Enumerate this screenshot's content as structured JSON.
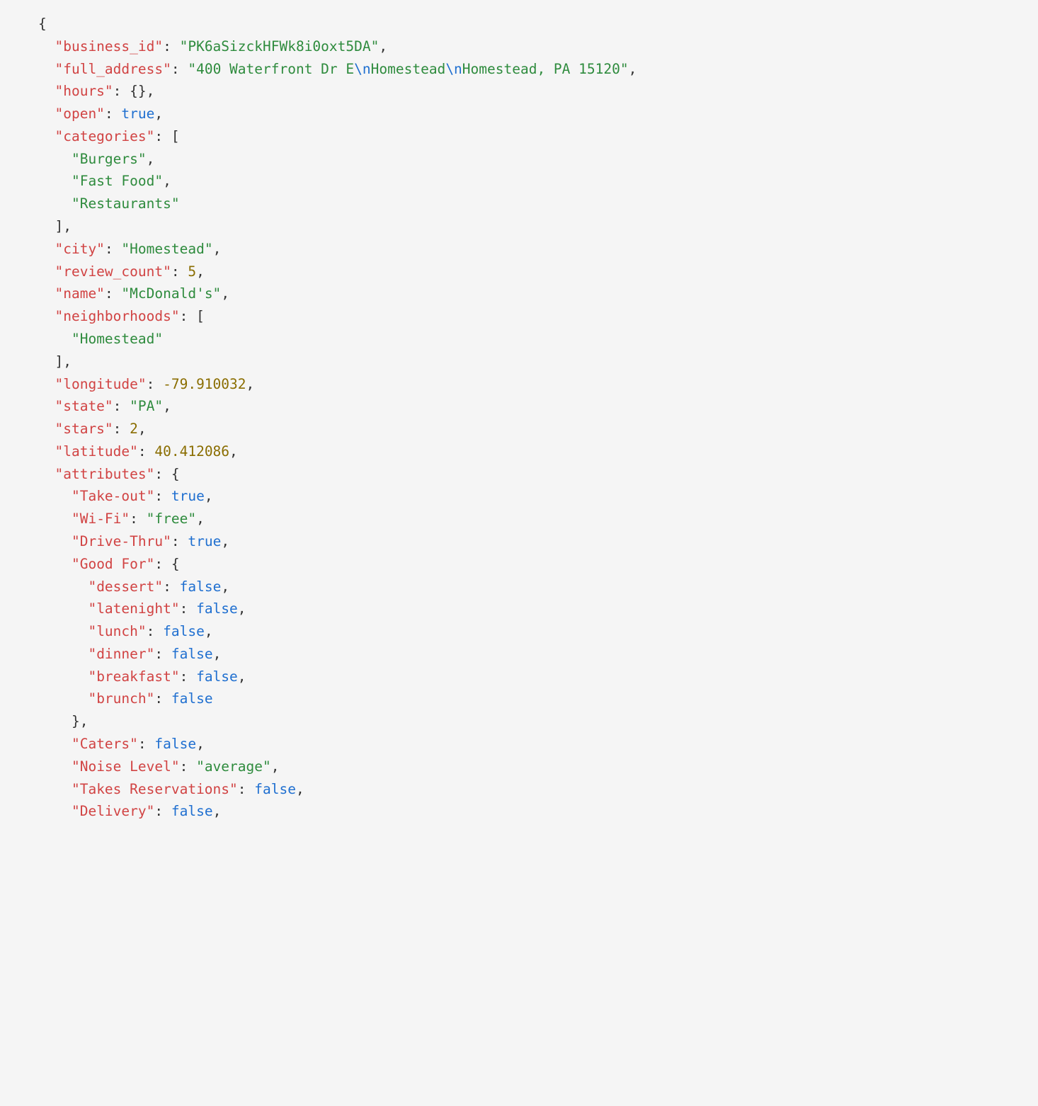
{
  "code": {
    "lines": [
      [
        {
          "cls": "pun",
          "t": "{"
        }
      ],
      [
        {
          "cls": "pun",
          "t": "  "
        },
        {
          "cls": "key",
          "t": "\"business_id\""
        },
        {
          "cls": "pun",
          "t": ": "
        },
        {
          "cls": "str",
          "t": "\"PK6aSizckHFWk8i0oxt5DA\""
        },
        {
          "cls": "pun",
          "t": ","
        }
      ],
      [
        {
          "cls": "pun",
          "t": "  "
        },
        {
          "cls": "key",
          "t": "\"full_address\""
        },
        {
          "cls": "pun",
          "t": ": "
        },
        {
          "cls": "str",
          "t": "\"400 Waterfront Dr E"
        },
        {
          "cls": "esc",
          "t": "\\n"
        },
        {
          "cls": "str",
          "t": "Homestead"
        },
        {
          "cls": "esc",
          "t": "\\n"
        },
        {
          "cls": "str",
          "t": "Homestead, PA 15120\""
        },
        {
          "cls": "pun",
          "t": ","
        }
      ],
      [
        {
          "cls": "pun",
          "t": "  "
        },
        {
          "cls": "key",
          "t": "\"hours\""
        },
        {
          "cls": "pun",
          "t": ": {},"
        }
      ],
      [
        {
          "cls": "pun",
          "t": "  "
        },
        {
          "cls": "key",
          "t": "\"open\""
        },
        {
          "cls": "pun",
          "t": ": "
        },
        {
          "cls": "bool",
          "t": "true"
        },
        {
          "cls": "pun",
          "t": ","
        }
      ],
      [
        {
          "cls": "pun",
          "t": "  "
        },
        {
          "cls": "key",
          "t": "\"categories\""
        },
        {
          "cls": "pun",
          "t": ": ["
        }
      ],
      [
        {
          "cls": "pun",
          "t": "    "
        },
        {
          "cls": "str",
          "t": "\"Burgers\""
        },
        {
          "cls": "pun",
          "t": ","
        }
      ],
      [
        {
          "cls": "pun",
          "t": "    "
        },
        {
          "cls": "str",
          "t": "\"Fast Food\""
        },
        {
          "cls": "pun",
          "t": ","
        }
      ],
      [
        {
          "cls": "pun",
          "t": "    "
        },
        {
          "cls": "str",
          "t": "\"Restaurants\""
        }
      ],
      [
        {
          "cls": "pun",
          "t": "  ],"
        }
      ],
      [
        {
          "cls": "pun",
          "t": "  "
        },
        {
          "cls": "key",
          "t": "\"city\""
        },
        {
          "cls": "pun",
          "t": ": "
        },
        {
          "cls": "str",
          "t": "\"Homestead\""
        },
        {
          "cls": "pun",
          "t": ","
        }
      ],
      [
        {
          "cls": "pun",
          "t": "  "
        },
        {
          "cls": "key",
          "t": "\"review_count\""
        },
        {
          "cls": "pun",
          "t": ": "
        },
        {
          "cls": "num",
          "t": "5"
        },
        {
          "cls": "pun",
          "t": ","
        }
      ],
      [
        {
          "cls": "pun",
          "t": "  "
        },
        {
          "cls": "key",
          "t": "\"name\""
        },
        {
          "cls": "pun",
          "t": ": "
        },
        {
          "cls": "str",
          "t": "\"McDonald's\""
        },
        {
          "cls": "pun",
          "t": ","
        }
      ],
      [
        {
          "cls": "pun",
          "t": "  "
        },
        {
          "cls": "key",
          "t": "\"neighborhoods\""
        },
        {
          "cls": "pun",
          "t": ": ["
        }
      ],
      [
        {
          "cls": "pun",
          "t": "    "
        },
        {
          "cls": "str",
          "t": "\"Homestead\""
        }
      ],
      [
        {
          "cls": "pun",
          "t": "  ],"
        }
      ],
      [
        {
          "cls": "pun",
          "t": "  "
        },
        {
          "cls": "key",
          "t": "\"longitude\""
        },
        {
          "cls": "pun",
          "t": ": "
        },
        {
          "cls": "num",
          "t": "-79.910032"
        },
        {
          "cls": "pun",
          "t": ","
        }
      ],
      [
        {
          "cls": "pun",
          "t": "  "
        },
        {
          "cls": "key",
          "t": "\"state\""
        },
        {
          "cls": "pun",
          "t": ": "
        },
        {
          "cls": "str",
          "t": "\"PA\""
        },
        {
          "cls": "pun",
          "t": ","
        }
      ],
      [
        {
          "cls": "pun",
          "t": "  "
        },
        {
          "cls": "key",
          "t": "\"stars\""
        },
        {
          "cls": "pun",
          "t": ": "
        },
        {
          "cls": "num",
          "t": "2"
        },
        {
          "cls": "pun",
          "t": ","
        }
      ],
      [
        {
          "cls": "pun",
          "t": "  "
        },
        {
          "cls": "key",
          "t": "\"latitude\""
        },
        {
          "cls": "pun",
          "t": ": "
        },
        {
          "cls": "num",
          "t": "40.412086"
        },
        {
          "cls": "pun",
          "t": ","
        }
      ],
      [
        {
          "cls": "pun",
          "t": "  "
        },
        {
          "cls": "key",
          "t": "\"attributes\""
        },
        {
          "cls": "pun",
          "t": ": {"
        }
      ],
      [
        {
          "cls": "pun",
          "t": "    "
        },
        {
          "cls": "key",
          "t": "\"Take-out\""
        },
        {
          "cls": "pun",
          "t": ": "
        },
        {
          "cls": "bool",
          "t": "true"
        },
        {
          "cls": "pun",
          "t": ","
        }
      ],
      [
        {
          "cls": "pun",
          "t": "    "
        },
        {
          "cls": "key",
          "t": "\"Wi-Fi\""
        },
        {
          "cls": "pun",
          "t": ": "
        },
        {
          "cls": "str",
          "t": "\"free\""
        },
        {
          "cls": "pun",
          "t": ","
        }
      ],
      [
        {
          "cls": "pun",
          "t": "    "
        },
        {
          "cls": "key",
          "t": "\"Drive-Thru\""
        },
        {
          "cls": "pun",
          "t": ": "
        },
        {
          "cls": "bool",
          "t": "true"
        },
        {
          "cls": "pun",
          "t": ","
        }
      ],
      [
        {
          "cls": "pun",
          "t": "    "
        },
        {
          "cls": "key",
          "t": "\"Good For\""
        },
        {
          "cls": "pun",
          "t": ": {"
        }
      ],
      [
        {
          "cls": "pun",
          "t": "      "
        },
        {
          "cls": "key",
          "t": "\"dessert\""
        },
        {
          "cls": "pun",
          "t": ": "
        },
        {
          "cls": "bool",
          "t": "false"
        },
        {
          "cls": "pun",
          "t": ","
        }
      ],
      [
        {
          "cls": "pun",
          "t": "      "
        },
        {
          "cls": "key",
          "t": "\"latenight\""
        },
        {
          "cls": "pun",
          "t": ": "
        },
        {
          "cls": "bool",
          "t": "false"
        },
        {
          "cls": "pun",
          "t": ","
        }
      ],
      [
        {
          "cls": "pun",
          "t": "      "
        },
        {
          "cls": "key",
          "t": "\"lunch\""
        },
        {
          "cls": "pun",
          "t": ": "
        },
        {
          "cls": "bool",
          "t": "false"
        },
        {
          "cls": "pun",
          "t": ","
        }
      ],
      [
        {
          "cls": "pun",
          "t": "      "
        },
        {
          "cls": "key",
          "t": "\"dinner\""
        },
        {
          "cls": "pun",
          "t": ": "
        },
        {
          "cls": "bool",
          "t": "false"
        },
        {
          "cls": "pun",
          "t": ","
        }
      ],
      [
        {
          "cls": "pun",
          "t": "      "
        },
        {
          "cls": "key",
          "t": "\"breakfast\""
        },
        {
          "cls": "pun",
          "t": ": "
        },
        {
          "cls": "bool",
          "t": "false"
        },
        {
          "cls": "pun",
          "t": ","
        }
      ],
      [
        {
          "cls": "pun",
          "t": "      "
        },
        {
          "cls": "key",
          "t": "\"brunch\""
        },
        {
          "cls": "pun",
          "t": ": "
        },
        {
          "cls": "bool",
          "t": "false"
        }
      ],
      [
        {
          "cls": "pun",
          "t": "    },"
        }
      ],
      [
        {
          "cls": "pun",
          "t": "    "
        },
        {
          "cls": "key",
          "t": "\"Caters\""
        },
        {
          "cls": "pun",
          "t": ": "
        },
        {
          "cls": "bool",
          "t": "false"
        },
        {
          "cls": "pun",
          "t": ","
        }
      ],
      [
        {
          "cls": "pun",
          "t": "    "
        },
        {
          "cls": "key",
          "t": "\"Noise Level\""
        },
        {
          "cls": "pun",
          "t": ": "
        },
        {
          "cls": "str",
          "t": "\"average\""
        },
        {
          "cls": "pun",
          "t": ","
        }
      ],
      [
        {
          "cls": "pun",
          "t": "    "
        },
        {
          "cls": "key",
          "t": "\"Takes Reservations\""
        },
        {
          "cls": "pun",
          "t": ": "
        },
        {
          "cls": "bool",
          "t": "false"
        },
        {
          "cls": "pun",
          "t": ","
        }
      ],
      [
        {
          "cls": "pun",
          "t": "    "
        },
        {
          "cls": "key",
          "t": "\"Delivery\""
        },
        {
          "cls": "pun",
          "t": ": "
        },
        {
          "cls": "bool",
          "t": "false"
        },
        {
          "cls": "pun",
          "t": ","
        }
      ]
    ]
  }
}
